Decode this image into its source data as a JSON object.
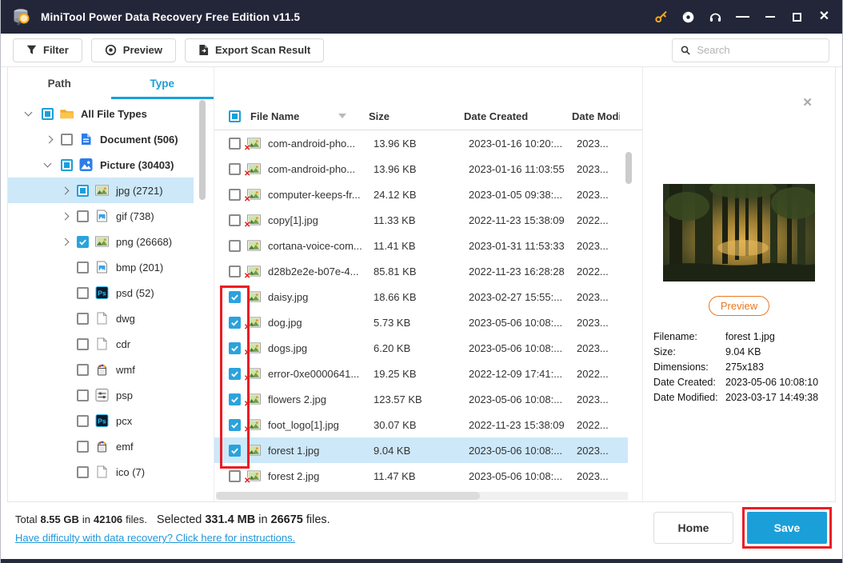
{
  "window": {
    "title": "MiniTool Power Data Recovery Free Edition v11.5"
  },
  "titlebar_icons": [
    "key-icon",
    "disc-icon",
    "headphones-icon",
    "menu-icon",
    "minimize-icon",
    "maximize-icon",
    "close-icon"
  ],
  "toolbar": {
    "buttons": [
      {
        "label": "Filter",
        "icon": "filter-icon"
      },
      {
        "label": "Preview",
        "icon": "preview-eye-icon"
      },
      {
        "label": "Export Scan Result",
        "icon": "export-icon"
      }
    ],
    "search_placeholder": "Search",
    "search_value": ""
  },
  "sidebar": {
    "tabs": [
      {
        "label": "Path",
        "active": false
      },
      {
        "label": "Type",
        "active": true
      }
    ],
    "tree": [
      {
        "label": "All File Types",
        "level": 0,
        "expander": "down",
        "checkbox": "indeterminate",
        "icon": "folder",
        "bold": true,
        "selected": false
      },
      {
        "label": "Document (506)",
        "level": 1,
        "expander": "right",
        "checkbox": "unchecked",
        "icon": "document",
        "bold": true,
        "selected": false
      },
      {
        "label": "Picture (30403)",
        "level": 1,
        "expander": "down",
        "checkbox": "indeterminate",
        "icon": "picture",
        "bold": true,
        "selected": false
      },
      {
        "label": "jpg (2721)",
        "level": 2,
        "expander": "right",
        "checkbox": "indeterminate",
        "icon": "photo",
        "bold": false,
        "selected": true
      },
      {
        "label": "gif (738)",
        "level": 2,
        "expander": "right",
        "checkbox": "unchecked",
        "icon": "image",
        "bold": false,
        "selected": false
      },
      {
        "label": "png (26668)",
        "level": 2,
        "expander": "right",
        "checkbox": "checked",
        "icon": "photo",
        "bold": false,
        "selected": false
      },
      {
        "label": "bmp (201)",
        "level": 2,
        "expander": "none",
        "checkbox": "unchecked",
        "icon": "image",
        "bold": false,
        "selected": false
      },
      {
        "label": "psd (52)",
        "level": 2,
        "expander": "none",
        "checkbox": "unchecked",
        "icon": "psd",
        "bold": false,
        "selected": false
      },
      {
        "label": "dwg",
        "level": 2,
        "expander": "none",
        "checkbox": "unchecked",
        "icon": "file",
        "bold": false,
        "selected": false
      },
      {
        "label": "cdr",
        "level": 2,
        "expander": "none",
        "checkbox": "unchecked",
        "icon": "file",
        "bold": false,
        "selected": false
      },
      {
        "label": "wmf",
        "level": 2,
        "expander": "none",
        "checkbox": "unchecked",
        "icon": "paint",
        "bold": false,
        "selected": false
      },
      {
        "label": "psp",
        "level": 2,
        "expander": "none",
        "checkbox": "unchecked",
        "icon": "sliders",
        "bold": false,
        "selected": false
      },
      {
        "label": "pcx",
        "level": 2,
        "expander": "none",
        "checkbox": "unchecked",
        "icon": "psd",
        "bold": false,
        "selected": false
      },
      {
        "label": "emf",
        "level": 2,
        "expander": "none",
        "checkbox": "unchecked",
        "icon": "paint",
        "bold": false,
        "selected": false
      },
      {
        "label": "ico (7)",
        "level": 2,
        "expander": "none",
        "checkbox": "unchecked",
        "icon": "file",
        "bold": false,
        "selected": false
      }
    ]
  },
  "table": {
    "columns": [
      "File Name",
      "Size",
      "Date Created",
      "Date Modif"
    ],
    "header_checkbox": "indeterminate",
    "rows": [
      {
        "name": "com-android-pho...",
        "size": "13.96 KB",
        "created": "2023-01-16 10:20:...",
        "modified": "2023...",
        "checked": false,
        "deleted": true,
        "highlight": false
      },
      {
        "name": "com-android-pho...",
        "size": "13.96 KB",
        "created": "2023-01-16 11:03:55",
        "modified": "2023...",
        "checked": false,
        "deleted": true,
        "highlight": false
      },
      {
        "name": "computer-keeps-fr...",
        "size": "24.12 KB",
        "created": "2023-01-05 09:38:...",
        "modified": "2023...",
        "checked": false,
        "deleted": true,
        "highlight": false
      },
      {
        "name": "copy[1].jpg",
        "size": "11.33 KB",
        "created": "2022-11-23 15:38:09",
        "modified": "2022...",
        "checked": false,
        "deleted": true,
        "highlight": false
      },
      {
        "name": "cortana-voice-com...",
        "size": "11.41 KB",
        "created": "2023-01-31 11:53:33",
        "modified": "2023...",
        "checked": false,
        "deleted": false,
        "highlight": false
      },
      {
        "name": "d28b2e2e-b07e-4...",
        "size": "85.81 KB",
        "created": "2022-11-23 16:28:28",
        "modified": "2022...",
        "checked": false,
        "deleted": true,
        "highlight": false
      },
      {
        "name": "daisy.jpg",
        "size": "18.66 KB",
        "created": "2023-02-27 15:55:...",
        "modified": "2023...",
        "checked": true,
        "deleted": false,
        "highlight": false
      },
      {
        "name": "dog.jpg",
        "size": "5.73 KB",
        "created": "2023-05-06 10:08:...",
        "modified": "2023...",
        "checked": true,
        "deleted": true,
        "highlight": false
      },
      {
        "name": "dogs.jpg",
        "size": "6.20 KB",
        "created": "2023-05-06 10:08:...",
        "modified": "2023...",
        "checked": true,
        "deleted": true,
        "highlight": false
      },
      {
        "name": "error-0xe0000641...",
        "size": "19.25 KB",
        "created": "2022-12-09 17:41:...",
        "modified": "2022...",
        "checked": true,
        "deleted": true,
        "highlight": false
      },
      {
        "name": "flowers 2.jpg",
        "size": "123.57 KB",
        "created": "2023-05-06 10:08:...",
        "modified": "2023...",
        "checked": true,
        "deleted": true,
        "highlight": false
      },
      {
        "name": "foot_logo[1].jpg",
        "size": "30.07 KB",
        "created": "2022-11-23 15:38:09",
        "modified": "2022...",
        "checked": true,
        "deleted": true,
        "highlight": false
      },
      {
        "name": "forest 1.jpg",
        "size": "9.04 KB",
        "created": "2023-05-06 10:08:...",
        "modified": "2023...",
        "checked": true,
        "deleted": false,
        "highlight": true
      },
      {
        "name": "forest 2.jpg",
        "size": "11.47 KB",
        "created": "2023-05-06 10:08:...",
        "modified": "2023...",
        "checked": false,
        "deleted": true,
        "highlight": false
      }
    ]
  },
  "preview_panel": {
    "close_glyph": "✕",
    "preview_button_label": "Preview",
    "details": [
      {
        "label": "Filename:",
        "value": "forest 1.jpg"
      },
      {
        "label": "Size:",
        "value": "9.04 KB"
      },
      {
        "label": "Dimensions:",
        "value": "275x183"
      },
      {
        "label": "Date Created:",
        "value": "2023-05-06 10:08:10"
      },
      {
        "label": "Date Modified:",
        "value": "2023-03-17 14:49:38"
      }
    ]
  },
  "footer": {
    "total_label": "Total",
    "total_size": "8.55 GB",
    "total_in": "in",
    "total_files": "42106",
    "total_suffix": "files.",
    "selected_label": "Selected",
    "selected_size": "331.4 MB",
    "selected_in": "in",
    "selected_files": "26675",
    "selected_suffix": "files.",
    "help_link": "Have difficulty with data recovery? Click here for instructions.",
    "home_label": "Home",
    "save_label": "Save"
  },
  "colors": {
    "titlebar_bg": "#232639",
    "accent_blue": "#1b9fd9",
    "row_highlight": "#cde8f9",
    "preview_orange": "#e87722",
    "annotation_red": "#ec1c24",
    "link_blue": "#2196d8",
    "key_gold": "#f2a81d"
  }
}
